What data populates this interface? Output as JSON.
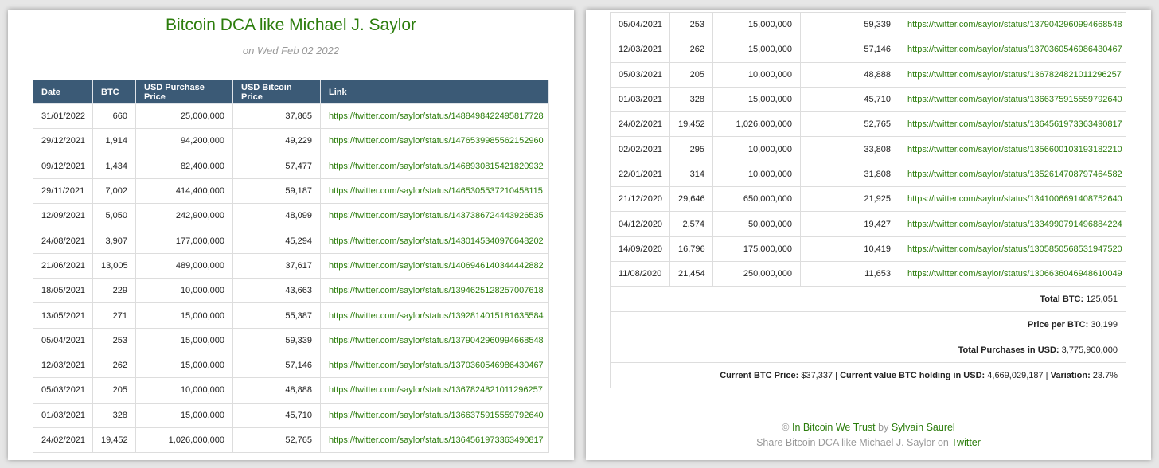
{
  "page": {
    "title": "Bitcoin DCA like Michael J. Saylor",
    "date": "on Wed Feb 02 2022"
  },
  "table": {
    "headers": [
      "Date",
      "BTC",
      "USD Purchase Price",
      "USD Bitcoin Price",
      "Link"
    ],
    "rows_left": [
      [
        "31/01/2022",
        "660",
        "25,000,000",
        "37,865",
        "https://twitter.com/saylor/status/1488498422495817728"
      ],
      [
        "29/12/2021",
        "1,914",
        "94,200,000",
        "49,229",
        "https://twitter.com/saylor/status/1476539985562152960"
      ],
      [
        "09/12/2021",
        "1,434",
        "82,400,000",
        "57,477",
        "https://twitter.com/saylor/status/1468930815421820932"
      ],
      [
        "29/11/2021",
        "7,002",
        "414,400,000",
        "59,187",
        "https://twitter.com/saylor/status/1465305537210458115"
      ],
      [
        "12/09/2021",
        "5,050",
        "242,900,000",
        "48,099",
        "https://twitter.com/saylor/status/1437386724443926535"
      ],
      [
        "24/08/2021",
        "3,907",
        "177,000,000",
        "45,294",
        "https://twitter.com/saylor/status/1430145340976648202"
      ],
      [
        "21/06/2021",
        "13,005",
        "489,000,000",
        "37,617",
        "https://twitter.com/saylor/status/1406946140344442882"
      ],
      [
        "18/05/2021",
        "229",
        "10,000,000",
        "43,663",
        "https://twitter.com/saylor/status/1394625128257007618"
      ],
      [
        "13/05/2021",
        "271",
        "15,000,000",
        "55,387",
        "https://twitter.com/saylor/status/1392814015181635584"
      ],
      [
        "05/04/2021",
        "253",
        "15,000,000",
        "59,339",
        "https://twitter.com/saylor/status/1379042960994668548"
      ],
      [
        "12/03/2021",
        "262",
        "15,000,000",
        "57,146",
        "https://twitter.com/saylor/status/1370360546986430467"
      ],
      [
        "05/03/2021",
        "205",
        "10,000,000",
        "48,888",
        "https://twitter.com/saylor/status/1367824821011296257"
      ],
      [
        "01/03/2021",
        "328",
        "15,000,000",
        "45,710",
        "https://twitter.com/saylor/status/1366375915559792640"
      ],
      [
        "24/02/2021",
        "19,452",
        "1,026,000,000",
        "52,765",
        "https://twitter.com/saylor/status/1364561973363490817"
      ]
    ],
    "rows_right": [
      [
        "05/04/2021",
        "253",
        "15,000,000",
        "59,339",
        "https://twitter.com/saylor/status/1379042960994668548"
      ],
      [
        "12/03/2021",
        "262",
        "15,000,000",
        "57,146",
        "https://twitter.com/saylor/status/1370360546986430467"
      ],
      [
        "05/03/2021",
        "205",
        "10,000,000",
        "48,888",
        "https://twitter.com/saylor/status/1367824821011296257"
      ],
      [
        "01/03/2021",
        "328",
        "15,000,000",
        "45,710",
        "https://twitter.com/saylor/status/1366375915559792640"
      ],
      [
        "24/02/2021",
        "19,452",
        "1,026,000,000",
        "52,765",
        "https://twitter.com/saylor/status/1364561973363490817"
      ],
      [
        "02/02/2021",
        "295",
        "10,000,000",
        "33,808",
        "https://twitter.com/saylor/status/1356600103193182210"
      ],
      [
        "22/01/2021",
        "314",
        "10,000,000",
        "31,808",
        "https://twitter.com/saylor/status/1352614708797464582"
      ],
      [
        "21/12/2020",
        "29,646",
        "650,000,000",
        "21,925",
        "https://twitter.com/saylor/status/1341006691408752640"
      ],
      [
        "04/12/2020",
        "2,574",
        "50,000,000",
        "19,427",
        "https://twitter.com/saylor/status/1334990791496884224"
      ],
      [
        "14/09/2020",
        "16,796",
        "175,000,000",
        "10,419",
        "https://twitter.com/saylor/status/1305850568531947520"
      ],
      [
        "11/08/2020",
        "21,454",
        "250,000,000",
        "11,653",
        "https://twitter.com/saylor/status/1306636046948610049"
      ]
    ]
  },
  "totals": {
    "total_btc_label": "Total BTC:",
    "total_btc_value": "125,051",
    "price_per_btc_label": "Price per BTC:",
    "price_per_btc_value": "30,199",
    "total_purchases_label": "Total Purchases in USD:",
    "total_purchases_value": "3,775,900,000",
    "current_price_label": "Current BTC Price:",
    "current_price_value": "$37,337",
    "separator": " | ",
    "current_value_label": "Current value BTC holding in USD:",
    "current_value_value": "4,669,029,187",
    "variation_label": "Variation:",
    "variation_value": "23.7%"
  },
  "footer": {
    "copyright": "©",
    "site_link": "In Bitcoin We Trust",
    "by": "by",
    "author_link": "Sylvain Saurel",
    "share_text": "Share Bitcoin DCA like Michael J. Saylor on",
    "twitter_link": "Twitter"
  },
  "colors": {
    "header_bg": "#3b5a76",
    "link_green": "#2c7d0c",
    "muted_gray": "#999999"
  }
}
